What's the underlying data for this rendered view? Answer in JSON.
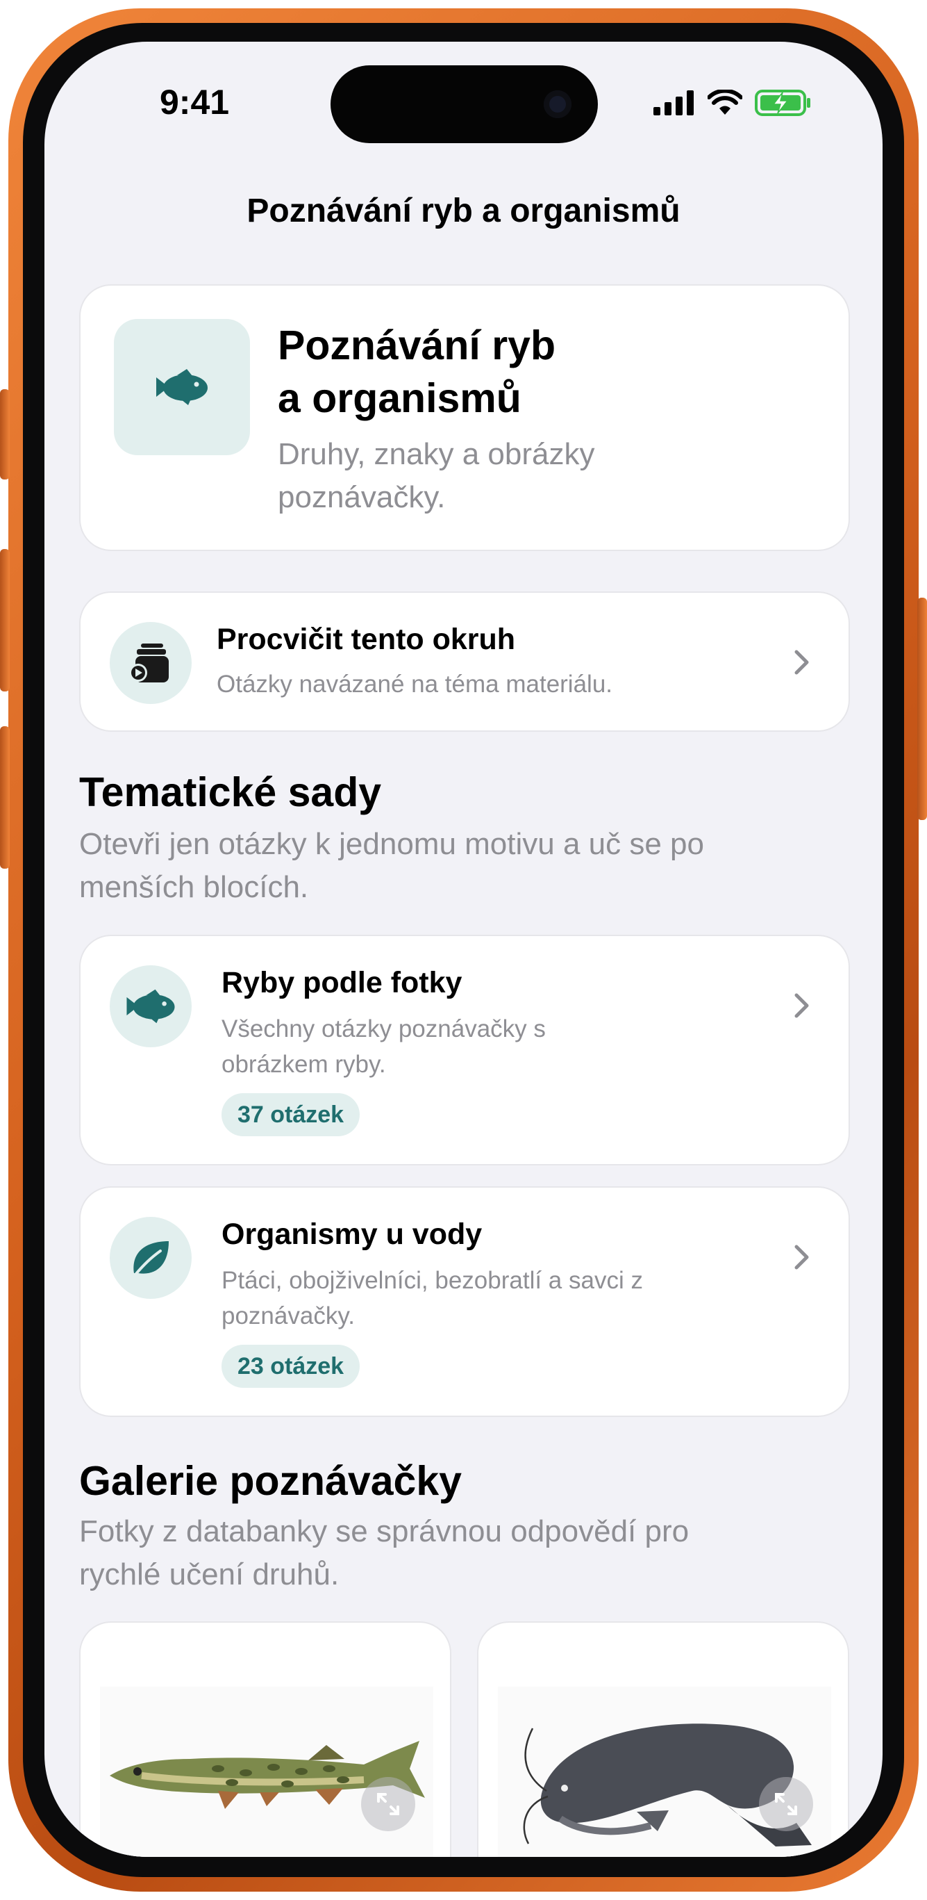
{
  "status_bar": {
    "time": "9:41"
  },
  "nav": {
    "title": "Poznávání ryb a organismů"
  },
  "hero": {
    "title_line1": "Poznávání ryb",
    "title_line2": "a organismů",
    "subtitle_line1": "Druhy, znaky a obrázky",
    "subtitle_line2": "poznávačky.",
    "icon": "fish-icon"
  },
  "practice": {
    "title": "Procvičit tento okruh",
    "subtitle": "Otázky navázané na téma materiálu.",
    "icon": "flashcards-play-icon"
  },
  "thematic": {
    "title": "Tematické sady",
    "subtitle_line1": "Otevři jen otázky k jednomu motivu a uč se po",
    "subtitle_line2": "menších blocích.",
    "items": [
      {
        "title": "Ryby podle fotky",
        "subtitle_line1": "Všechny otázky poznávačky s",
        "subtitle_line2": "obrázkem ryby.",
        "count": "37 otázek",
        "icon": "fish-icon"
      },
      {
        "title": "Organismy u vody",
        "subtitle_line1": "Ptáci, obojživelníci, bezobratlí a savci z",
        "subtitle_line2": "poznávačky.",
        "count": "23 otázek",
        "icon": "leaf-icon"
      }
    ]
  },
  "gallery": {
    "title": "Galerie poznávačky",
    "subtitle_line1": "Fotky z databanky se správnou odpovědí pro",
    "subtitle_line2": "rychlé učení druhů.",
    "items": [
      {
        "image": "pike-fish-illustration"
      },
      {
        "image": "catfish-illustration"
      }
    ]
  },
  "colors": {
    "frame": "#e2762e",
    "accent": "#1f6e6e",
    "tile_bg": "#e2efee",
    "screen_bg": "#f2f2f7"
  }
}
